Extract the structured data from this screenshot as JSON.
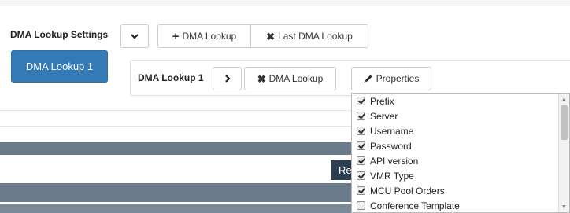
{
  "settings": {
    "title": "DMA Lookup Settings",
    "add_label": "DMA Lookup",
    "remove_last_label": "Last DMA Lookup"
  },
  "tabs": [
    {
      "label": "DMA Lookup 1",
      "active": true
    }
  ],
  "lookup": {
    "title": "DMA Lookup 1",
    "remove_label": "DMA Lookup",
    "properties_label": "Properties"
  },
  "partial_button_label": "Re",
  "properties_menu": {
    "items": [
      {
        "label": "Prefix",
        "checked": true
      },
      {
        "label": "Server",
        "checked": true
      },
      {
        "label": "Username",
        "checked": true
      },
      {
        "label": "Password",
        "checked": true
      },
      {
        "label": "API version",
        "checked": true
      },
      {
        "label": "VMR Type",
        "checked": true
      },
      {
        "label": "MCU Pool Orders",
        "checked": true
      },
      {
        "label": "Conference Template",
        "checked": false
      }
    ]
  },
  "colors": {
    "primary": "#337ab7",
    "header_bar": "#6b7b8c",
    "dark_button": "#2c3e50"
  },
  "icons": {
    "collapse": "chevron-down-icon",
    "add": "plus-icon",
    "remove": "times-icon",
    "expand": "chevron-right-icon",
    "properties": "pencil-icon"
  }
}
